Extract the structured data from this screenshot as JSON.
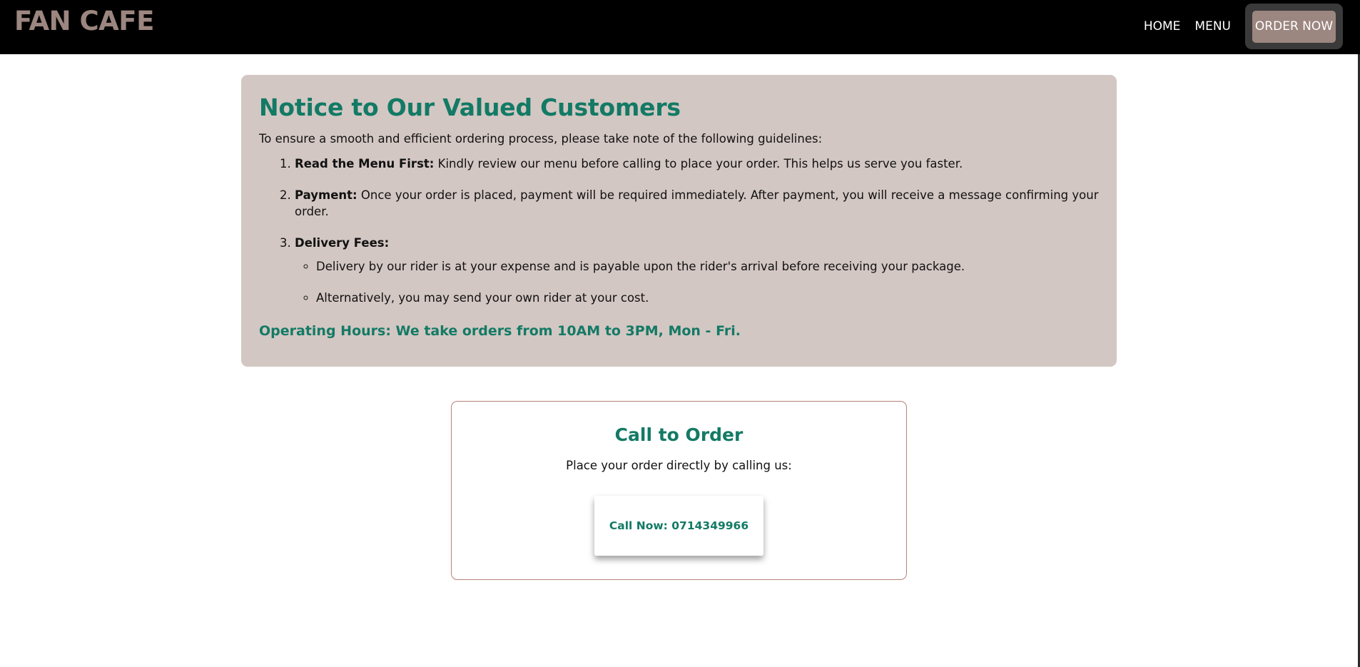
{
  "header": {
    "brand": "FAN CAFE",
    "nav": {
      "home": "HOME",
      "menu": "MENU",
      "order_now": "ORDER NOW"
    }
  },
  "notice": {
    "title": "Notice to Our Valued Customers",
    "intro": "To ensure a smooth and efficient ordering process, please take note of the following guidelines:",
    "items": [
      {
        "label": "Read the Menu First:",
        "text": " Kindly review our menu before calling to place your order. This helps us serve you faster."
      },
      {
        "label": "Payment:",
        "text": " Once your order is placed, payment will be required immediately. After payment, you will receive a message confirming your order."
      },
      {
        "label": "Delivery Fees:",
        "subitems": [
          "Delivery by our rider is at your expense and is payable upon the rider's arrival before receiving your package.",
          "Alternatively, you may send your own rider at your cost."
        ]
      }
    ],
    "hours": "Operating Hours: We take orders from 10AM to 3PM, Mon - Fri."
  },
  "call_card": {
    "title": "Call to Order",
    "text": "Place your order directly by calling us:",
    "button": "Call Now: 0714349966"
  },
  "colors": {
    "accent": "#137a65",
    "brand": "#9c8680",
    "notice_bg": "#d3c7c3",
    "navbar_bg": "#000000"
  }
}
